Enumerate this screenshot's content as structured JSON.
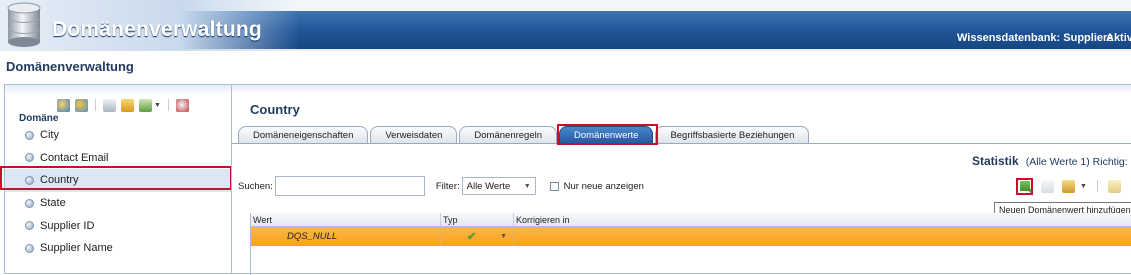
{
  "banner": {
    "title": "Domänenverwaltung",
    "knowledge_base": "Wissensdatenbank: Suppliers",
    "status": "Aktiv"
  },
  "page_heading": "Domänenverwaltung",
  "left": {
    "domain_label": "Domäne",
    "domains": [
      "City",
      "Contact Email",
      "Country",
      "State",
      "Supplier ID",
      "Supplier Name"
    ],
    "selected": "Country"
  },
  "right": {
    "title": "Country",
    "tabs": [
      "Domäneneigenschaften",
      "Verweisdaten",
      "Domänenregeln",
      "Domänenwerte",
      "Begriffsbasierte Beziehungen"
    ],
    "active_tab": "Domänenwerte",
    "stats": {
      "title": "Statistik",
      "text": "(Alle Werte 1) Richtig:"
    },
    "search": {
      "label": "Suchen:",
      "value": ""
    },
    "filter": {
      "label": "Filter:",
      "selected": "Alle Werte"
    },
    "only_new": {
      "label": "Nur neue anzeigen",
      "checked": false
    },
    "tooltip": "Neuen Domänenwert hinzufügen",
    "grid": {
      "columns": [
        "Wert",
        "Typ",
        "Korrigieren in"
      ],
      "rows": [
        {
          "value": "DQS_NULL",
          "type": "correct",
          "correct_to": ""
        }
      ]
    }
  },
  "colors": {
    "banner_blue": "#1f5396",
    "selected_row": "#f7a21f",
    "highlight": "#c8102e",
    "active_tab": "#1e5ca7"
  }
}
